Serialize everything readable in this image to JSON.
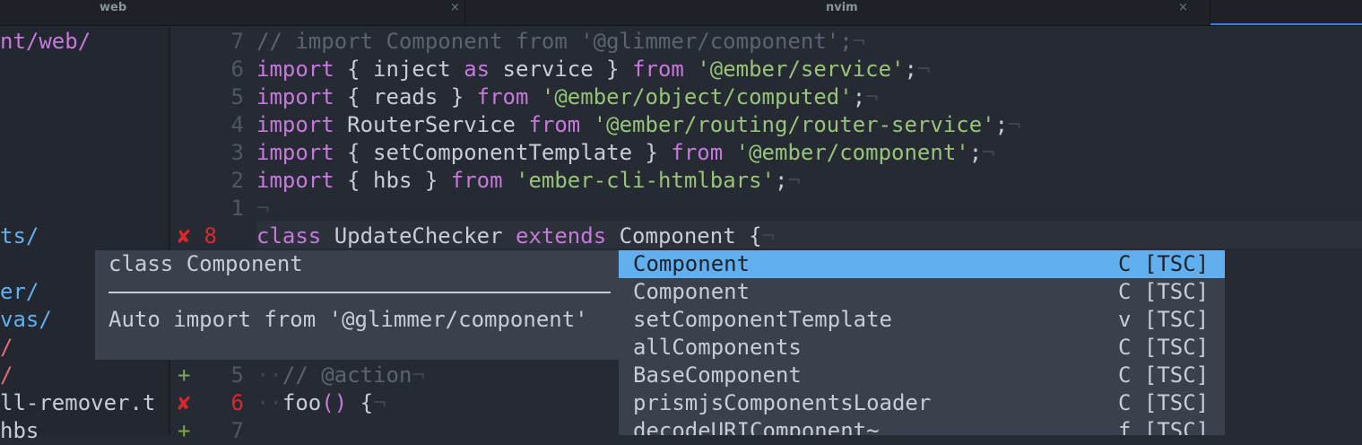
{
  "tabs": [
    {
      "name": "web",
      "close": "×"
    },
    {
      "name": "nvim",
      "close": "×"
    }
  ],
  "sidebar": {
    "lines": [
      {
        "text": "nt/web/",
        "color": "#c678dd"
      },
      {
        "text": "ts/",
        "color": "#61afef"
      },
      {
        "text": "er/",
        "color": "#61afef"
      },
      {
        "text": "vas/",
        "color": "#61afef"
      },
      {
        "text": "/",
        "color": "#e06c75"
      },
      {
        "text": "/",
        "color": "#e06c75"
      },
      {
        "text": "ll-remover.t",
        "color": "#c8ccd4"
      },
      {
        "text": "hbs",
        "color": "#c8ccd4"
      }
    ]
  },
  "gutter": {
    "upper": [
      "7",
      "6",
      "5",
      "4",
      "3",
      "2",
      "1",
      "8"
    ],
    "lower": [
      "5",
      "6",
      "7"
    ],
    "error_sign": "✘",
    "add_sign": "+"
  },
  "code": {
    "lines": [
      [
        {
          "t": "// import Component from '@glimmer/component';",
          "c": "cm"
        },
        {
          "t": "¬",
          "c": "ws"
        }
      ],
      [
        {
          "t": "import",
          "c": "kw"
        },
        {
          "t": " { inject ",
          "c": ""
        },
        {
          "t": "as",
          "c": "kw"
        },
        {
          "t": " service } ",
          "c": ""
        },
        {
          "t": "from",
          "c": "kw"
        },
        {
          "t": " ",
          "c": ""
        },
        {
          "t": "'@ember/service'",
          "c": "str"
        },
        {
          "t": ";",
          "c": ""
        },
        {
          "t": "¬",
          "c": "ws"
        }
      ],
      [
        {
          "t": "import",
          "c": "kw"
        },
        {
          "t": " { reads } ",
          "c": ""
        },
        {
          "t": "from",
          "c": "kw"
        },
        {
          "t": " ",
          "c": ""
        },
        {
          "t": "'@ember/object/computed'",
          "c": "str"
        },
        {
          "t": ";",
          "c": ""
        },
        {
          "t": "¬",
          "c": "ws"
        }
      ],
      [
        {
          "t": "import",
          "c": "kw"
        },
        {
          "t": " RouterService ",
          "c": ""
        },
        {
          "t": "from",
          "c": "kw"
        },
        {
          "t": " ",
          "c": ""
        },
        {
          "t": "'@ember/routing/router-service'",
          "c": "str"
        },
        {
          "t": ";",
          "c": ""
        },
        {
          "t": "¬",
          "c": "ws"
        }
      ],
      [
        {
          "t": "import",
          "c": "kw"
        },
        {
          "t": " { setComponentTemplate } ",
          "c": ""
        },
        {
          "t": "from",
          "c": "kw"
        },
        {
          "t": " ",
          "c": ""
        },
        {
          "t": "'@ember/component'",
          "c": "str"
        },
        {
          "t": ";",
          "c": ""
        },
        {
          "t": "¬",
          "c": "ws"
        }
      ],
      [
        {
          "t": "import",
          "c": "kw"
        },
        {
          "t": " { hbs } ",
          "c": ""
        },
        {
          "t": "from",
          "c": "kw"
        },
        {
          "t": " ",
          "c": ""
        },
        {
          "t": "'ember-cli-htmlbars'",
          "c": "str"
        },
        {
          "t": ";",
          "c": ""
        },
        {
          "t": "¬",
          "c": "ws"
        }
      ],
      [
        {
          "t": "¬",
          "c": "ws"
        }
      ],
      [
        {
          "t": "class",
          "c": "kw"
        },
        {
          "t": " UpdateChecker ",
          "c": ""
        },
        {
          "t": "extends",
          "c": "kw"
        },
        {
          "t": " Component {",
          "c": ""
        },
        {
          "t": "¬",
          "c": "ws"
        }
      ]
    ],
    "lower_lines": [
      [
        {
          "t": "··",
          "c": "ws"
        },
        {
          "t": "// @action",
          "c": "cm"
        },
        {
          "t": "¬",
          "c": "ws"
        }
      ],
      [
        {
          "t": "··",
          "c": "ws"
        },
        {
          "t": "foo",
          "c": ""
        },
        {
          "t": "()",
          "c": "kw"
        },
        {
          "t": " {",
          "c": ""
        },
        {
          "t": "¬",
          "c": "ws"
        }
      ]
    ]
  },
  "hover": {
    "title": "class Component",
    "body": "Auto import from '@glimmer/component'"
  },
  "completion": {
    "items": [
      {
        "word": "Component",
        "kind": "C [TSC]",
        "selected": true
      },
      {
        "word": "Component",
        "kind": "C [TSC]",
        "selected": false
      },
      {
        "word": "setComponentTemplate",
        "kind": "v [TSC]",
        "selected": false
      },
      {
        "word": "allComponents",
        "kind": "C [TSC]",
        "selected": false
      },
      {
        "word": "BaseComponent",
        "kind": "C [TSC]",
        "selected": false
      },
      {
        "word": "prismjsComponentsLoader",
        "kind": "C [TSC]",
        "selected": false
      },
      {
        "word": "decodeURIComponent~",
        "kind": "f [TSC]",
        "selected": false
      }
    ]
  },
  "colors": {
    "background": "#262b33",
    "keyword": "#c678dd",
    "string": "#98c379",
    "comment": "#5c6370",
    "error": "#e0262d",
    "added": "#7fa650",
    "selection": "#61afef"
  }
}
